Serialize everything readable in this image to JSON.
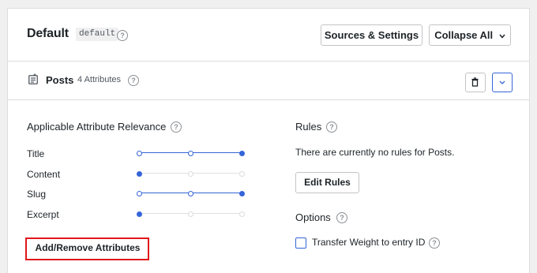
{
  "header": {
    "title": "Default",
    "tag": "default",
    "help": "?",
    "sources_button": "Sources & Settings",
    "collapse_button": "Collapse All",
    "collapse_chevron": "⌄"
  },
  "source": {
    "title": "Posts",
    "count": "4 Attributes",
    "help": "?",
    "icon": "document-icon",
    "trash_icon": "trash-icon",
    "toggle_icon": "chevron-down-icon"
  },
  "relevance": {
    "title": "Applicable Attribute Relevance",
    "help": "?",
    "attributes": [
      {
        "label": "Title",
        "level": 1.0
      },
      {
        "label": "Content",
        "level": 0.0
      },
      {
        "label": "Slug",
        "level": 1.0
      },
      {
        "label": "Excerpt",
        "level": 0.0
      }
    ],
    "add_remove_button": "Add/Remove Attributes"
  },
  "rules": {
    "title": "Rules",
    "help": "?",
    "empty_text": "There are currently no rules for Posts.",
    "edit_button": "Edit Rules"
  },
  "options": {
    "title": "Options",
    "help": "?",
    "transfer_weight_label": "Transfer Weight to entry ID",
    "transfer_weight_checked": false,
    "transfer_help": "?"
  },
  "colors": {
    "accent": "#3565d8",
    "highlight": "#e0161b"
  }
}
